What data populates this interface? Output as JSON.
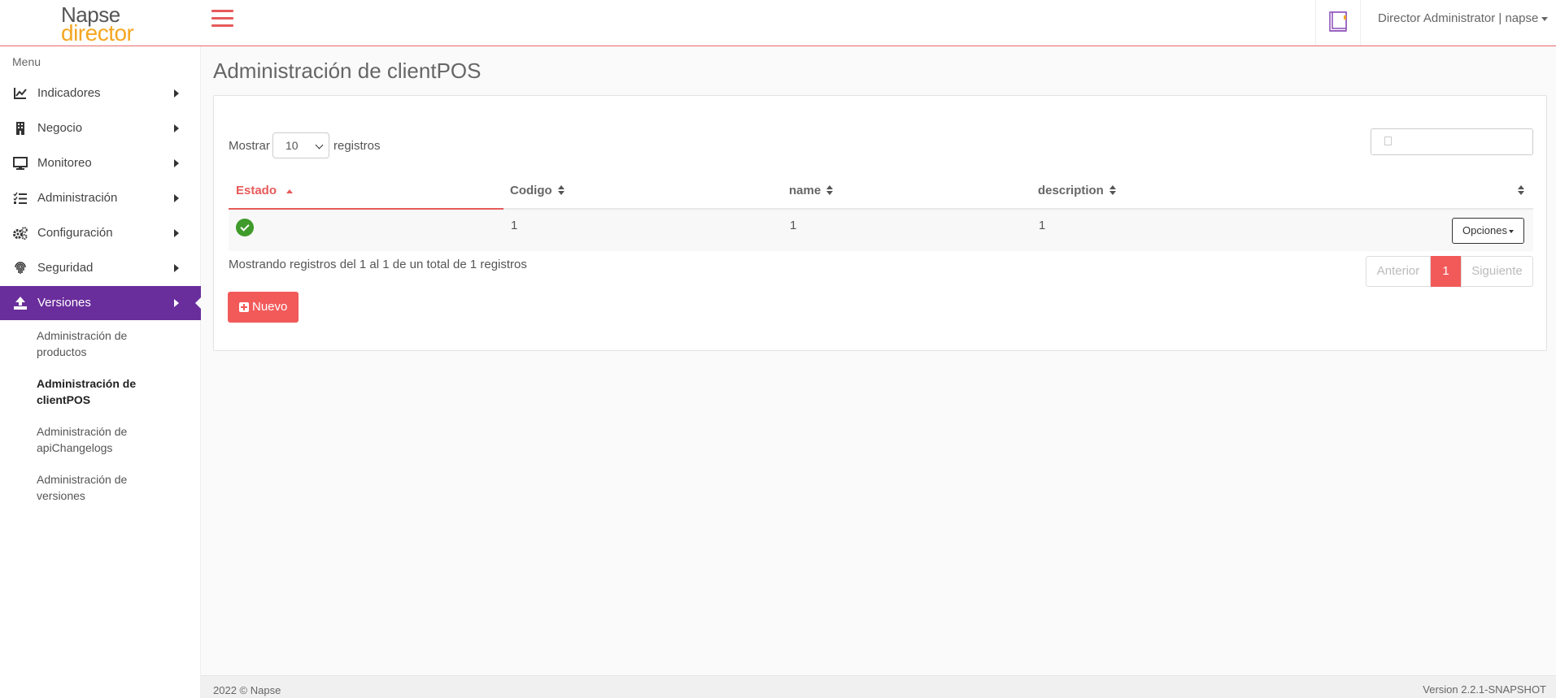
{
  "header": {
    "logo_line1": "Napse",
    "logo_line2": "director",
    "user_label": "Director Administrator | napse"
  },
  "sidebar": {
    "menu_title": "Menu",
    "items": [
      {
        "label": "Indicadores",
        "icon": "chart-line-icon"
      },
      {
        "label": "Negocio",
        "icon": "building-icon"
      },
      {
        "label": "Monitoreo",
        "icon": "monitor-icon"
      },
      {
        "label": "Administración",
        "icon": "list-check-icon"
      },
      {
        "label": "Configuración",
        "icon": "gears-icon"
      },
      {
        "label": "Seguridad",
        "icon": "fingerprint-icon"
      },
      {
        "label": "Versiones",
        "icon": "upload-icon"
      }
    ],
    "sub_items": [
      {
        "line1": "Administración de",
        "line2": "productos"
      },
      {
        "line1": "Administración de",
        "line2": "clientPOS"
      },
      {
        "line1": "Administración de",
        "line2": "apiChangelogs"
      },
      {
        "line1": "Administración de",
        "line2": "versiones"
      }
    ]
  },
  "main": {
    "title": "Administración de clientPOS",
    "show_label": "Mostrar",
    "page_size": "10",
    "records_label": "registros",
    "columns": [
      "Estado",
      "Codigo",
      "name",
      "description"
    ],
    "rows": [
      {
        "codigo": "1",
        "name": "1",
        "description": "1",
        "options_label": "Opciones"
      }
    ],
    "info": "Mostrando registros del 1 al 1 de un total de 1 registros",
    "pager": {
      "prev": "Anterior",
      "current": "1",
      "next": "Siguiente"
    },
    "new_button": "Nuevo"
  },
  "footer": {
    "copyright": "2022 © Napse",
    "version": "Version 2.2.1-SNAPSHOT"
  },
  "colors": {
    "accent": "#f25a5a",
    "active_menu": "#6a2d9c",
    "status_ok": "#3f9b2a",
    "logo_orange": "#f5a623"
  }
}
